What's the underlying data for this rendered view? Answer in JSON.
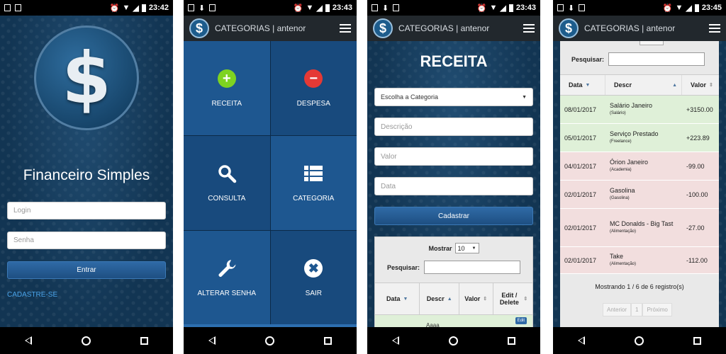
{
  "status": {
    "panel1_time": "23:42",
    "panel2_time": "23:43",
    "panel3_time": "23:43",
    "panel4_time": "23:45"
  },
  "appbar": {
    "title": "CATEGORIAS | antenor",
    "logo_glyph": "$"
  },
  "login": {
    "logo_glyph": "$",
    "app_name": "Financeiro Simples",
    "login_placeholder": "Login",
    "senha_placeholder": "Senha",
    "entrar_label": "Entrar",
    "cadastre_label": "CADASTRE-SE"
  },
  "menu": {
    "items": [
      {
        "label": "RECEITA",
        "icon": "plus-circle-icon",
        "color": "#7ed321"
      },
      {
        "label": "DESPESA",
        "icon": "minus-circle-icon",
        "color": "#e53935"
      },
      {
        "label": "CONSULTA",
        "icon": "search-icon",
        "color": "#ffffff"
      },
      {
        "label": "CATEGORIA",
        "icon": "list-icon",
        "color": "#ffffff"
      },
      {
        "label": "ALTERAR SENHA",
        "icon": "wrench-icon",
        "color": "#ffffff"
      },
      {
        "label": "SAIR",
        "icon": "close-circle-icon",
        "color": "#ffffff"
      }
    ]
  },
  "receita": {
    "title": "RECEITA",
    "categoria_placeholder": "Escolha a Categoria",
    "descricao_placeholder": "Descrição",
    "valor_placeholder": "Valor",
    "data_placeholder": "Data",
    "cadastrar_label": "Cadastrar",
    "mostrar_label": "Mostrar",
    "mostrar_value": "10",
    "pesquisar_label": "Pesquisar:",
    "columns": [
      "Data",
      "Descr",
      "Valor",
      "Edit / Delete"
    ],
    "partial_row_text": "Aaaa",
    "edit_label": "Edit"
  },
  "consulta": {
    "pesquisar_label": "Pesquisar:",
    "columns": [
      "Data",
      "Descr",
      "Valor"
    ],
    "rows": [
      {
        "data": "08/01/2017",
        "descr": "Salário Janeiro",
        "cat": "(Salário)",
        "valor": "+3150.00",
        "kind": "green"
      },
      {
        "data": "05/01/2017",
        "descr": "Serviço Prestado",
        "cat": "(Freelance)",
        "valor": "+223.89",
        "kind": "green"
      },
      {
        "data": "04/01/2017",
        "descr": "Órion Janeiro",
        "cat": "(Academia)",
        "valor": "-99.00",
        "kind": "red"
      },
      {
        "data": "02/01/2017",
        "descr": "Gasolina",
        "cat": "(Gasolina)",
        "valor": "-100.00",
        "kind": "red"
      },
      {
        "data": "02/01/2017",
        "descr": "MC Donalds - Big Tast",
        "cat": "(Alimentação)",
        "valor": "-27.00",
        "kind": "red"
      },
      {
        "data": "02/01/2017",
        "descr": "Take",
        "cat": "(Alimentação)",
        "valor": "-112.00",
        "kind": "red"
      }
    ],
    "footer": "Mostrando 1 / 6 de 6 registro(s)",
    "pager": {
      "prev": "Anterior",
      "page": "1",
      "next": "Próximo"
    }
  }
}
